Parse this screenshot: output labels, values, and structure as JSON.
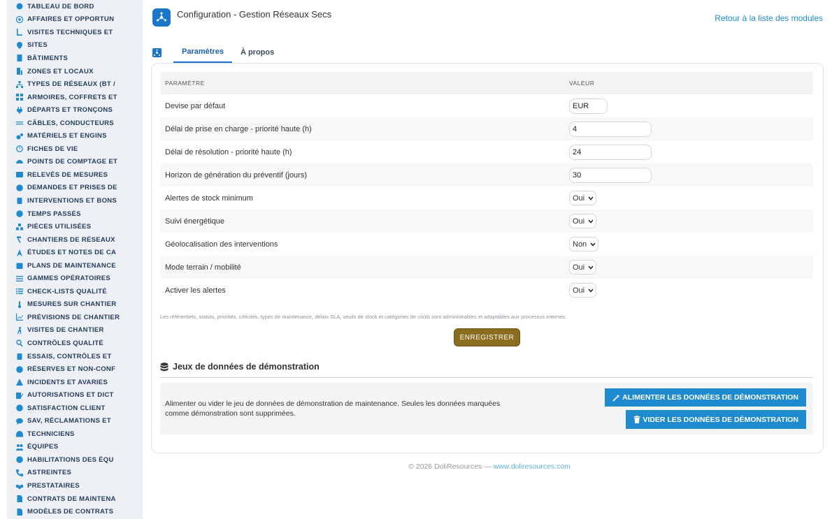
{
  "sidebar": {
    "items": [
      {
        "label": "TABLEAU DE BORD",
        "icon": "dashboard-icon"
      },
      {
        "label": "AFFAIRES ET OPPORTUN",
        "icon": "target-icon"
      },
      {
        "label": "VISITES TECHNIQUES ET",
        "icon": "angle-icon"
      },
      {
        "label": "SITES",
        "icon": "map-pin-icon"
      },
      {
        "label": "BÂTIMENTS",
        "icon": "building-icon"
      },
      {
        "label": "ZONES ET LOCAUX",
        "icon": "door-icon"
      },
      {
        "label": "TYPES DE RÉSEAUX (BT /",
        "icon": "network-icon"
      },
      {
        "label": "ARMOIRES, COFFRETS ET",
        "icon": "grid-icon"
      },
      {
        "label": "DÉPARTS ET TRONÇONS",
        "icon": "plug-icon"
      },
      {
        "label": "CÂBLES, CONDUCTEURS",
        "icon": "lines-icon"
      },
      {
        "label": "MATÉRIELS ET ENGINS",
        "icon": "gears-icon"
      },
      {
        "label": "FICHES DE VIE",
        "icon": "history-icon"
      },
      {
        "label": "POINTS DE COMPTAGE ET",
        "icon": "gauge-icon"
      },
      {
        "label": "RELEVÉS DE MESURES",
        "icon": "ruler-icon"
      },
      {
        "label": "DEMANDES ET PRISES DE",
        "icon": "question-icon"
      },
      {
        "label": "INTERVENTIONS ET BONS",
        "icon": "clipboard-icon"
      },
      {
        "label": "TEMPS PASSÉS",
        "icon": "clock-icon"
      },
      {
        "label": "PIÈCES UTILISÉES",
        "icon": "boxes-icon"
      },
      {
        "label": "CHANTIERS DE RÉSEAUX",
        "icon": "hammer-icon"
      },
      {
        "label": "ÉTUDES ET NOTES DE CA",
        "icon": "compass-icon"
      },
      {
        "label": "PLANS DE MAINTENANCE",
        "icon": "calendar-icon"
      },
      {
        "label": "GAMMES OPÉRATOIRES",
        "icon": "list-icon"
      },
      {
        "label": "CHECK-LISTS QUALITÉ",
        "icon": "checklist-icon"
      },
      {
        "label": "MESURES SUR CHANTIER",
        "icon": "thermometer-icon"
      },
      {
        "label": "PRÉVISIONS DE CHANTIER",
        "icon": "chart-line-icon"
      },
      {
        "label": "VISITES DE CHANTIER",
        "icon": "walking-icon"
      },
      {
        "label": "CONTRÔLES QUALITÉ",
        "icon": "search-icon"
      },
      {
        "label": "ESSAIS, CONTRÔLES ET",
        "icon": "clipboard-check-icon"
      },
      {
        "label": "RÉSERVES ET NON-CONF",
        "icon": "exclamation-icon"
      },
      {
        "label": "INCIDENTS ET AVARIES",
        "icon": "warning-icon"
      },
      {
        "label": "AUTORISATIONS ET DICT",
        "icon": "signature-icon"
      },
      {
        "label": "SATISFACTION CLIENT",
        "icon": "smile-icon"
      },
      {
        "label": "SAV, RÉCLAMATIONS ET",
        "icon": "comment-icon"
      },
      {
        "label": "TECHNICIENS",
        "icon": "hard-hat-icon"
      },
      {
        "label": "ÉQUIPES",
        "icon": "users-icon"
      },
      {
        "label": "HABILITATIONS DES ÉQU",
        "icon": "certificate-icon"
      },
      {
        "label": "ASTREINTES",
        "icon": "phone-icon"
      },
      {
        "label": "PRESTATAIRES",
        "icon": "handshake-icon"
      },
      {
        "label": "CONTRATS DE MAINTENA",
        "icon": "file-contract-icon"
      },
      {
        "label": "MODÈLES DE CONTRATS",
        "icon": "file-icon"
      }
    ]
  },
  "header": {
    "title": "Configuration - Gestion Réseaux Secs",
    "back_link": "Retour à la liste des modules"
  },
  "tabs": {
    "params": "Paramètres",
    "about": "À propos"
  },
  "table": {
    "col_param": "PARAMÈTRE",
    "col_value": "VALEUR",
    "rows": [
      {
        "label": "Devise par défaut",
        "type": "text",
        "value": "EUR",
        "width": "short"
      },
      {
        "label": "Délai de prise en charge - priorité haute (h)",
        "type": "text",
        "value": "4",
        "width": "long"
      },
      {
        "label": "Délai de résolution - priorité haute (h)",
        "type": "text",
        "value": "24",
        "width": "long"
      },
      {
        "label": "Horizon de génération du préventif (jours)",
        "type": "text",
        "value": "30",
        "width": "long"
      },
      {
        "label": "Alertes de stock minimum",
        "type": "select",
        "value": "Oui"
      },
      {
        "label": "Suivi énergétique",
        "type": "select",
        "value": "Oui"
      },
      {
        "label": "Géolocalisation des interventions",
        "type": "select",
        "value": "Non"
      },
      {
        "label": "Mode terrain / mobilité",
        "type": "select",
        "value": "Oui"
      },
      {
        "label": "Activer les alertes",
        "type": "select",
        "value": "Oui"
      }
    ]
  },
  "note": "Les référentiels, statuts, priorités, criticités, types de maintenance, délais SLA, seuils de stock et catégories de coûts sont administrables et adaptables aux processus internes.",
  "save_button": "ENREGISTRER",
  "demo": {
    "title": "Jeux de données de démonstration",
    "description": "Alimenter ou vider le jeu de données de démonstration de maintenance. Seules les données marquées comme démonstration sont supprimées.",
    "feed_button": "ALIMENTER LES DONNÉES DE DÉMONSTRATION",
    "clear_button": "VIDER LES DONNÉES DE DÉMONSTRATION"
  },
  "footer": {
    "copyright": "© 2026 DoliResources — ",
    "link": "www.doliresources.com"
  },
  "colors": {
    "accent": "#1e8ad0",
    "save": "#8a6d1e",
    "sidebar_bg": "#edf1f6"
  }
}
